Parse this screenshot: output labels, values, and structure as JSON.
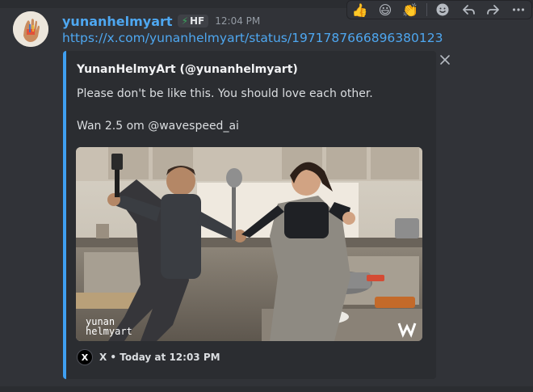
{
  "message": {
    "username": "yunanhelmyart",
    "role_badge": "HF",
    "role_badge_icon": "lightning-bolt-icon",
    "timestamp": "12:04 PM",
    "link": "https://x.com/yunanhelmyart/status/1971787666896380123"
  },
  "toolbar": {
    "reactions": [
      "👍",
      "😃",
      "👏"
    ],
    "actions": [
      "add-reaction-icon",
      "reply-icon",
      "forward-icon",
      "more-icon"
    ]
  },
  "embed": {
    "author": "YunanHelmyArt (@yunanhelmyart)",
    "description_line1": "Please don't be like this. You should love each other.",
    "description_line2": "Wan 2.5 om @wavespeed_ai",
    "watermark_line1": "yunan",
    "watermark_line2": "helmyart",
    "footer_logo": "X",
    "footer_text": "X • Today at 12:03 PM",
    "accent_color": "#3f9ff0"
  }
}
